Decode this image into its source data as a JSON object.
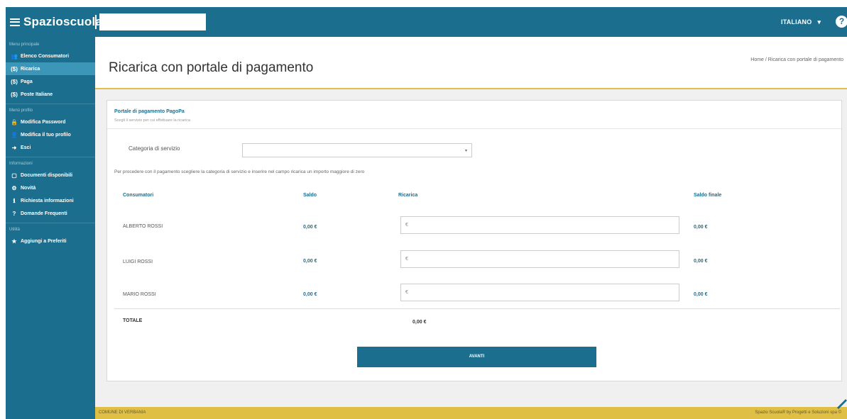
{
  "topbar": {
    "brand": "Spazioscuola",
    "language": "ITALIANO",
    "help": "?"
  },
  "sidebar": {
    "sections": [
      {
        "title": "Menu principale",
        "items": [
          {
            "label": "Elenco Consumatori",
            "icon": "users-icon",
            "active": false
          },
          {
            "label": "Ricarica",
            "icon": "money-icon",
            "active": true
          },
          {
            "label": "Paga",
            "icon": "money-icon",
            "active": false
          },
          {
            "label": "Poste Italiane",
            "icon": "money-icon",
            "active": false
          }
        ]
      },
      {
        "title": "Menù profilo",
        "items": [
          {
            "label": "Modifica Password",
            "icon": "lock-icon",
            "active": false
          },
          {
            "label": "Modifica il tuo profilo",
            "icon": "user-icon",
            "active": false
          },
          {
            "label": "Esci",
            "icon": "logout-icon",
            "active": false
          }
        ]
      },
      {
        "title": "Informazioni",
        "items": [
          {
            "label": "Documenti disponibili",
            "icon": "document-icon",
            "active": false
          },
          {
            "label": "Novità",
            "icon": "gear-icon",
            "active": false
          },
          {
            "label": "Richiesta informazioni",
            "icon": "info-icon",
            "active": false
          },
          {
            "label": "Domande Frequenti",
            "icon": "question-icon",
            "active": false
          }
        ]
      },
      {
        "title": "Utilità",
        "items": [
          {
            "label": "Aggiungi a Preferiti",
            "icon": "star-icon",
            "active": false
          }
        ]
      }
    ]
  },
  "page": {
    "title": "Ricarica con portale di pagamento",
    "breadcrumb": "Home  /  Ricarica con portale di pagamento"
  },
  "panel": {
    "title": "Portale di pagamento PagoPa",
    "subtitle": "Scegli il servizio per cui effettuare la ricarica",
    "category_label": "Categoria di servizio",
    "category_value": "",
    "instruction": "Per procedere con il pagamento scegliere la categoria di servizio e inserire nel campo ricarica un importo maggiore di zero",
    "columns": {
      "consumatori": "Consumatori",
      "saldo": "Saldo",
      "ricarica": "Ricarica",
      "saldo_finale": "Saldo finale"
    },
    "rows": [
      {
        "name": "ALBERTO ROSSI",
        "saldo": "0,00 €",
        "ricarica_placeholder": "€",
        "saldo_finale": "0,00 €"
      },
      {
        "name": "LUIGI ROSSI",
        "saldo": "0,00 €",
        "ricarica_placeholder": "€",
        "saldo_finale": "0,00 €"
      },
      {
        "name": "MARIO ROSSI",
        "saldo": "0,00 €",
        "ricarica_placeholder": "€",
        "saldo_finale": "0,00 €"
      }
    ],
    "total_label": "TOTALE",
    "total_value": "0,00 €",
    "next_button": "AVANTI"
  },
  "footer": {
    "left": "COMUNE DI VERBANIA",
    "right": "Spazio Scuola® by Progetti e Soluzioni spa ©"
  },
  "colors": {
    "primary": "#1b6e8e",
    "accent": "#e0bf45",
    "active_item": "#3c96b7"
  }
}
